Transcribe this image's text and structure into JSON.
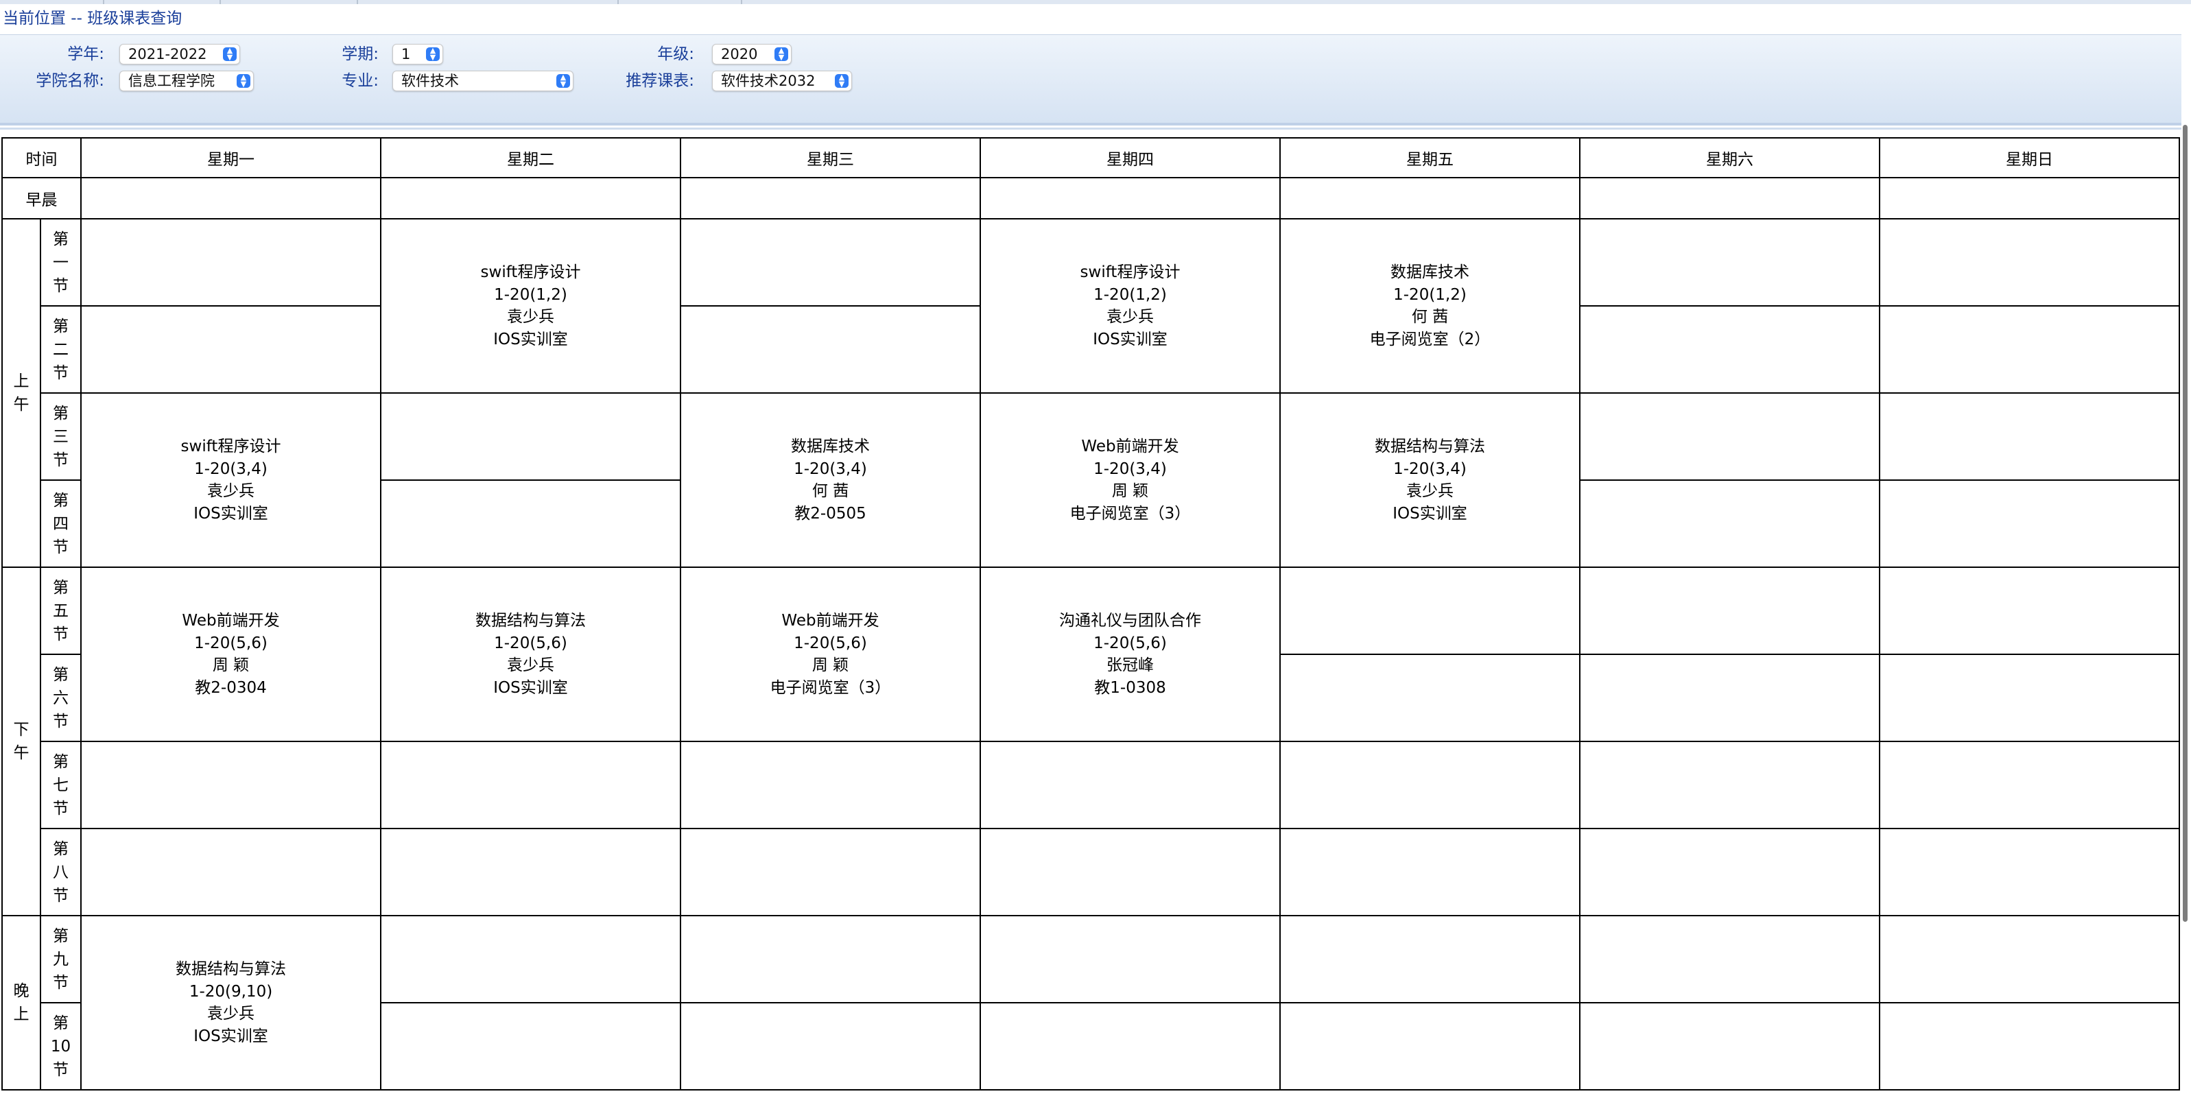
{
  "breadcrumb": "当前位置 -- 班级课表查询",
  "filters": {
    "year_label": "学年:",
    "year_value": "2021-2022",
    "term_label": "学期:",
    "term_value": "1",
    "grade_label": "年级:",
    "grade_value": "2020",
    "college_label": "学院名称:",
    "college_value": "信息工程学院",
    "major_label": "专业:",
    "major_value": "软件技术",
    "recommend_label": "推荐课表:",
    "recommend_value": "软件技术2032"
  },
  "table": {
    "time_header": "时间",
    "days": [
      "星期一",
      "星期二",
      "星期三",
      "星期四",
      "星期五",
      "星期六",
      "星期日"
    ],
    "early": "早晨",
    "sections": {
      "morning": "上午",
      "afternoon": "下午",
      "evening": "晚上"
    },
    "periods": [
      "第一节",
      "第二节",
      "第三节",
      "第四节",
      "第五节",
      "第六节",
      "第七节",
      "第八节",
      "第九节",
      "第10节"
    ]
  },
  "courses": {
    "p12_tue": {
      "name": "swift程序设计",
      "weeks": "1-20(1,2)",
      "teacher": "袁少兵",
      "room": "IOS实训室"
    },
    "p12_thu": {
      "name": "swift程序设计",
      "weeks": "1-20(1,2)",
      "teacher": "袁少兵",
      "room": "IOS实训室"
    },
    "p12_fri": {
      "name": "数据库技术",
      "weeks": "1-20(1,2)",
      "teacher": "何 茜",
      "room": "电子阅览室（2）"
    },
    "p34_mon": {
      "name": "swift程序设计",
      "weeks": "1-20(3,4)",
      "teacher": "袁少兵",
      "room": "IOS实训室"
    },
    "p34_wed": {
      "name": "数据库技术",
      "weeks": "1-20(3,4)",
      "teacher": "何 茜",
      "room": "教2-0505"
    },
    "p34_thu": {
      "name": "Web前端开发",
      "weeks": "1-20(3,4)",
      "teacher": "周 颖",
      "room": "电子阅览室（3）"
    },
    "p34_fri": {
      "name": "数据结构与算法",
      "weeks": "1-20(3,4)",
      "teacher": "袁少兵",
      "room": "IOS实训室"
    },
    "p56_mon": {
      "name": "Web前端开发",
      "weeks": "1-20(5,6)",
      "teacher": "周 颖",
      "room": "教2-0304"
    },
    "p56_tue": {
      "name": "数据结构与算法",
      "weeks": "1-20(5,6)",
      "teacher": "袁少兵",
      "room": "IOS实训室"
    },
    "p56_wed": {
      "name": "Web前端开发",
      "weeks": "1-20(5,6)",
      "teacher": "周 颖",
      "room": "电子阅览室（3）"
    },
    "p56_thu": {
      "name": "沟通礼仪与团队合作",
      "weeks": "1-20(5,6)",
      "teacher": "张冠峰",
      "room": "教1-0308"
    },
    "p910_mon": {
      "name": "数据结构与算法",
      "weeks": "1-20(9,10)",
      "teacher": "袁少兵",
      "room": "IOS实训室"
    }
  }
}
